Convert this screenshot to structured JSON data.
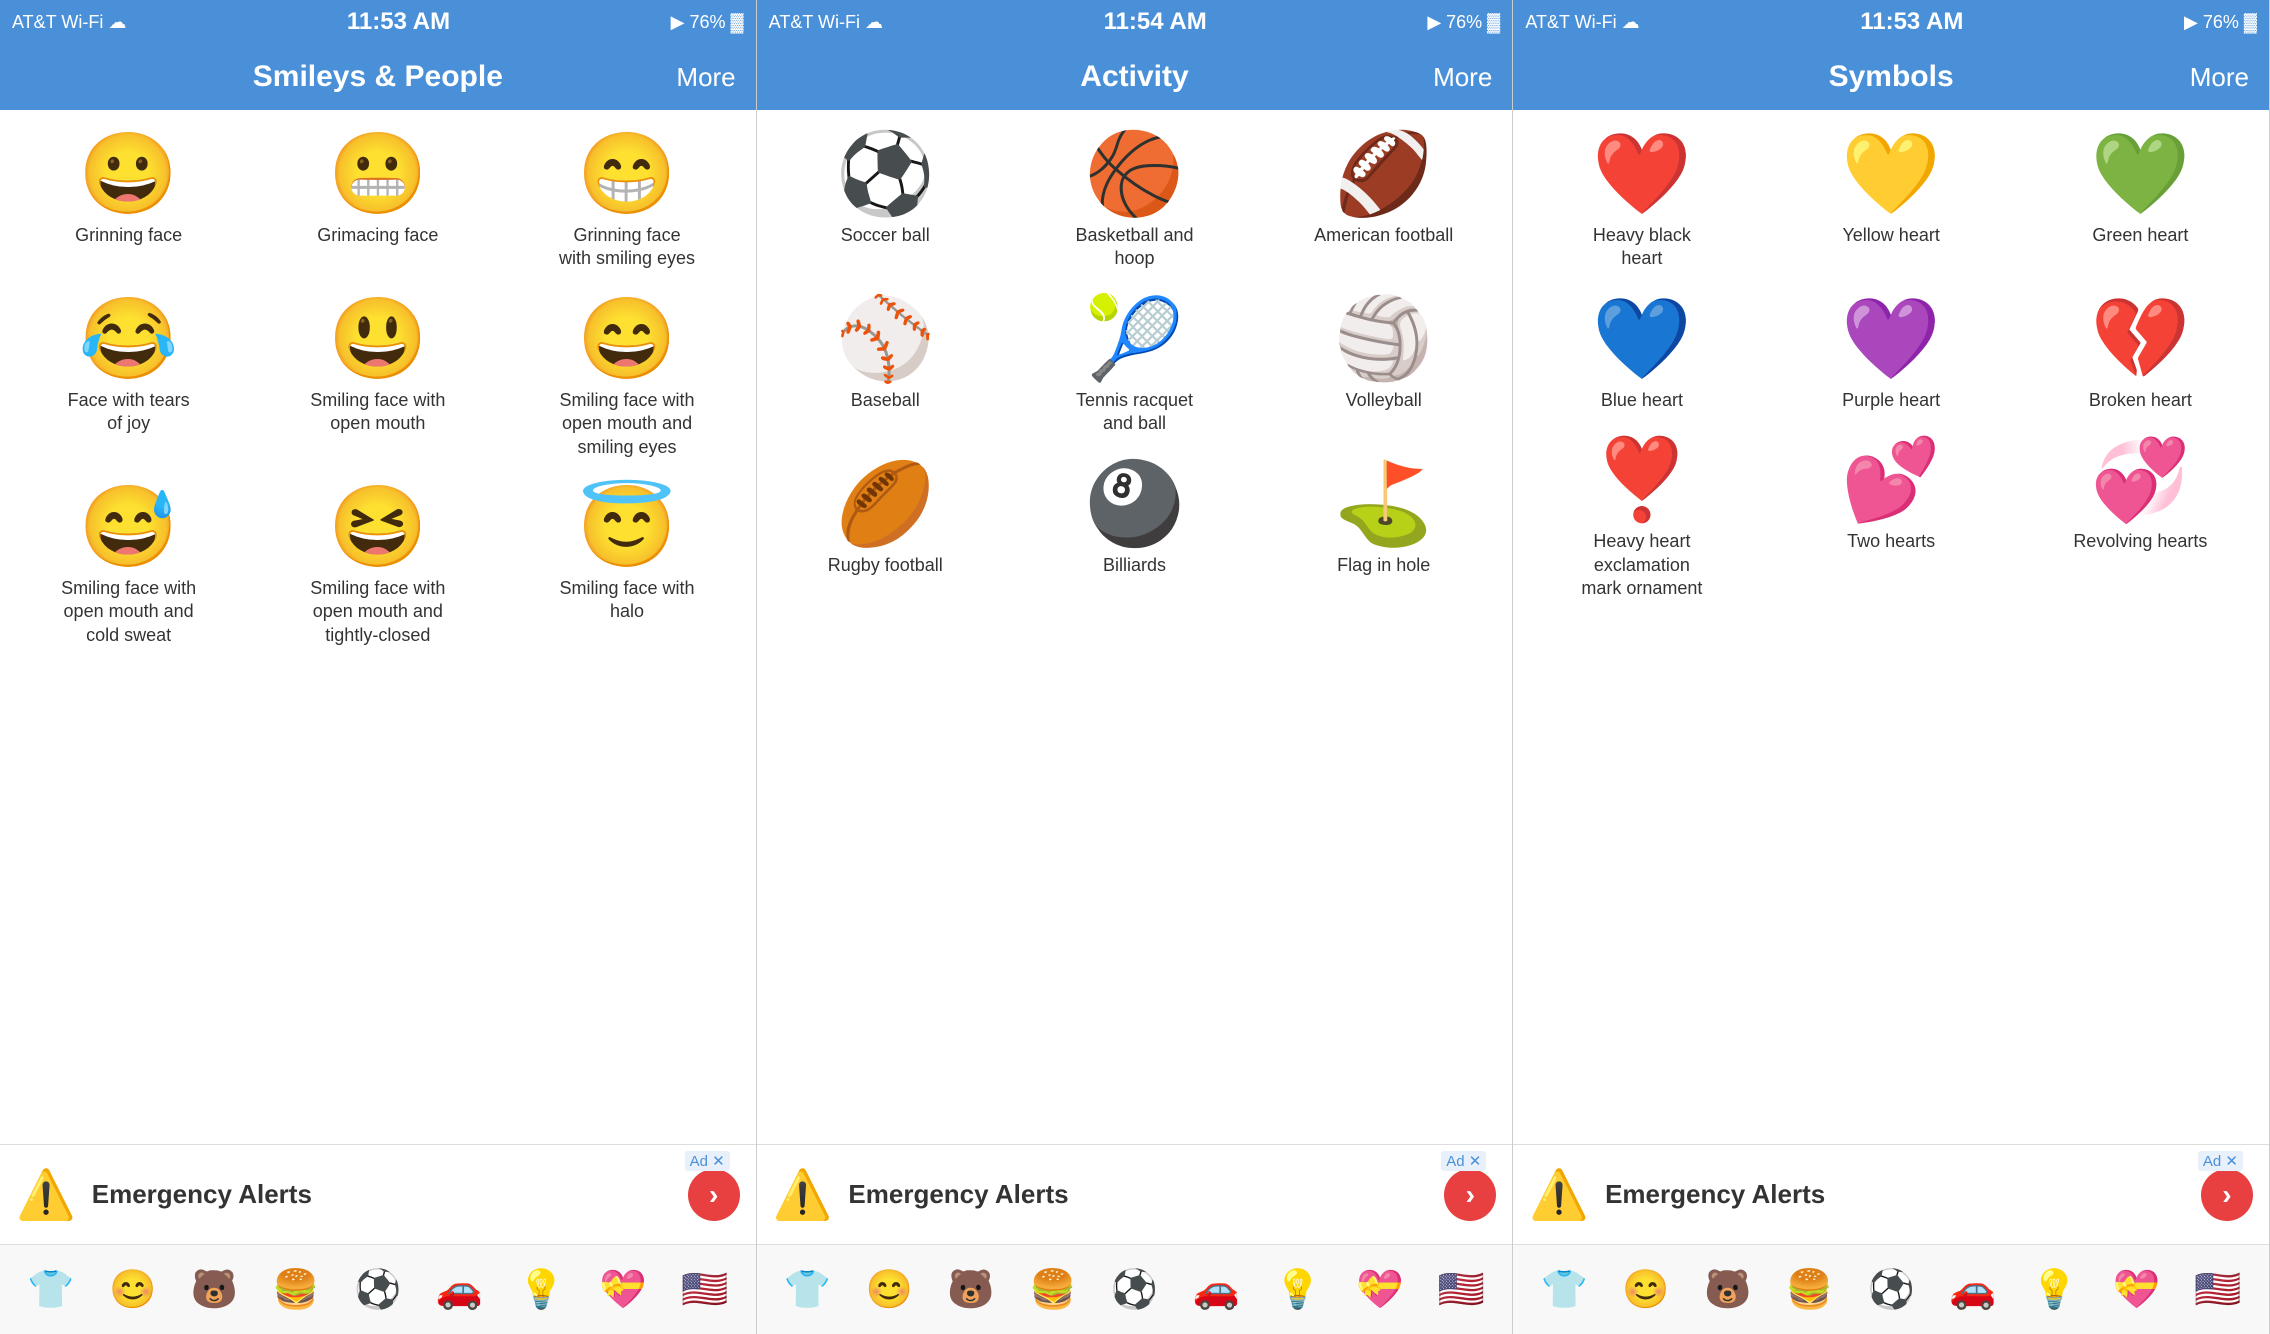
{
  "panels": [
    {
      "id": "smileys",
      "statusBar": {
        "left": "AT&T Wi-Fi ✦",
        "center": "11:53 AM",
        "right": "▶ 76% 🔋"
      },
      "navTitle": "Smileys & People",
      "navMore": "More",
      "emojis": [
        {
          "icon": "😀",
          "label": "Grinning face"
        },
        {
          "icon": "😬",
          "label": "Grimacing face"
        },
        {
          "icon": "😁",
          "label": "Grinning face with smiling eyes"
        },
        {
          "icon": "😂",
          "label": "Face with tears of joy"
        },
        {
          "icon": "😃",
          "label": "Smiling face with open mouth"
        },
        {
          "icon": "😄",
          "label": "Smiling face with open mouth and smiling eyes"
        },
        {
          "icon": "😅",
          "label": "Smiling face with open mouth and cold sweat"
        },
        {
          "icon": "😆",
          "label": "Smiling face with open mouth and tightly-closed"
        },
        {
          "icon": "😇",
          "label": "Smiling face with halo"
        }
      ],
      "bottomEmojis": [
        "👕",
        "😊",
        "🐻",
        "🍔",
        "⚽",
        "🚗",
        "💡",
        "💝",
        "🇺🇸"
      ]
    },
    {
      "id": "activity",
      "statusBar": {
        "left": "AT&T Wi-Fi ✦",
        "center": "11:54 AM",
        "right": "▶ 76% 🔋"
      },
      "navTitle": "Activity",
      "navMore": "More",
      "emojis": [
        {
          "icon": "⚽",
          "label": "Soccer ball"
        },
        {
          "icon": "🏀",
          "label": "Basketball and hoop"
        },
        {
          "icon": "🏈",
          "label": "American football"
        },
        {
          "icon": "⚾",
          "label": "Baseball"
        },
        {
          "icon": "🎾",
          "label": "Tennis racquet and ball"
        },
        {
          "icon": "🏐",
          "label": "Volleyball"
        },
        {
          "icon": "🏉",
          "label": "Rugby football"
        },
        {
          "icon": "🎱",
          "label": "Billiards"
        },
        {
          "icon": "⛳",
          "label": "Flag in hole"
        }
      ],
      "bottomEmojis": [
        "👕",
        "😊",
        "🐻",
        "🍔",
        "⚽",
        "🚗",
        "💡",
        "💝",
        "🇺🇸"
      ]
    },
    {
      "id": "symbols",
      "statusBar": {
        "left": "AT&T Wi-Fi ✦",
        "center": "11:53 AM",
        "right": "▶ 76% 🔋"
      },
      "navTitle": "Symbols",
      "navMore": "More",
      "emojis": [
        {
          "icon": "❤️",
          "label": "Heavy black heart"
        },
        {
          "icon": "💛",
          "label": "Yellow heart"
        },
        {
          "icon": "💚",
          "label": "Green heart"
        },
        {
          "icon": "💙",
          "label": "Blue heart"
        },
        {
          "icon": "💜",
          "label": "Purple heart"
        },
        {
          "icon": "💔",
          "label": "Broken heart"
        },
        {
          "icon": "❣️",
          "label": "Heavy heart exclamation mark ornament"
        },
        {
          "icon": "💕",
          "label": "Two hearts"
        },
        {
          "icon": "💞",
          "label": "Revolving hearts"
        }
      ],
      "bottomEmojis": [
        "👕",
        "😊",
        "🐻",
        "🍔",
        "⚽",
        "🚗",
        "💡",
        "💝",
        "🇺🇸"
      ]
    }
  ],
  "adLabel": "Emergency Alerts",
  "adWarningIcon": "⚠️"
}
